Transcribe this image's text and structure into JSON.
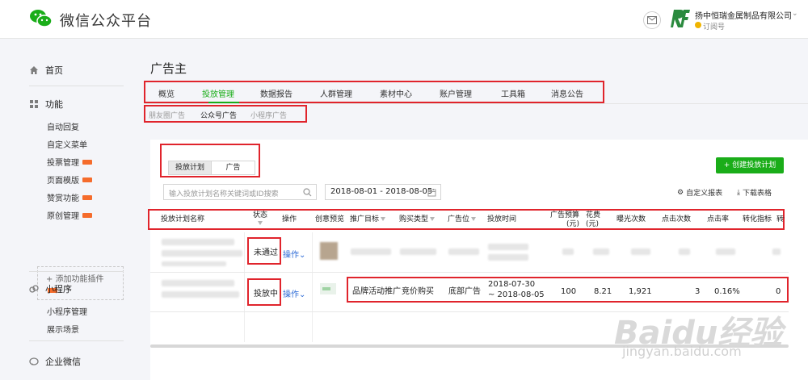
{
  "header": {
    "brand": "微信公众平台",
    "account_name": "扬中恒瑞金属制品有限公司",
    "account_type": "订阅号",
    "icons": [
      "wechat-logo-icon",
      "mail-icon",
      "account-logo-icon",
      "chevron-down-icon"
    ]
  },
  "sidebar": {
    "home": "首页",
    "features": "功能",
    "feature_items": [
      "自动回复",
      "自定义菜单",
      "投票管理",
      "页面模版",
      "赞赏功能",
      "原创管理"
    ],
    "add_plugin": "添加功能插件",
    "miniprogram": "小程序",
    "mini_items": [
      "小程序管理",
      "展示场景"
    ],
    "work_wechat": "企业微信"
  },
  "main": {
    "title": "广告主",
    "tabs": [
      "概览",
      "投放管理",
      "数据报告",
      "人群管理",
      "素材中心",
      "账户管理",
      "工具箱",
      "消息公告"
    ],
    "active_tab": "投放管理",
    "subtabs": [
      "朋友圈广告",
      "公众号广告",
      "小程序广告"
    ],
    "active_subtab": "公众号广告",
    "segments": [
      "投放计划",
      "广告"
    ],
    "create_button": "+ 创建投放计划",
    "search_placeholder": "输入投放计划名称关键词或ID搜索",
    "date_range": "2018-08-01 - 2018-08-05",
    "custom_report": "自定义报表",
    "download_table": "下载表格",
    "accent_color": "#1aad19",
    "highlight_color": "#e0242c"
  },
  "table": {
    "headers": {
      "name": "投放计划名称",
      "status": "状态",
      "operation": "操作",
      "creative": "创意预览",
      "goal": "推广目标",
      "buy_type": "购买类型",
      "position": "广告位",
      "time": "投放时间",
      "budget": "广告预算(元)",
      "cost": "花费(元)",
      "impressions": "曝光次数",
      "clicks": "点击次数",
      "ctr": "点击率",
      "conversion": "转化指标",
      "extra": "转化"
    },
    "rows": [
      {
        "status": "未通过",
        "operation": "操作",
        "goal": "",
        "buy_type": "",
        "position": "",
        "time": "",
        "budget": "",
        "cost": "",
        "impressions": "",
        "clicks": "",
        "ctr": "",
        "conversion": ""
      },
      {
        "status": "投放中",
        "operation": "操作",
        "goal": "品牌活动推广",
        "buy_type": "竞价购买",
        "position": "底部广告",
        "time_start": "2018-07-30",
        "time_end": "~ 2018-08-05",
        "budget": "100",
        "cost": "8.21",
        "impressions": "1,921",
        "clicks": "3",
        "ctr": "0.16%",
        "conversion": "0"
      }
    ]
  },
  "watermark": {
    "main": "Baidu经验",
    "url": "jingyan.baidu.com"
  }
}
